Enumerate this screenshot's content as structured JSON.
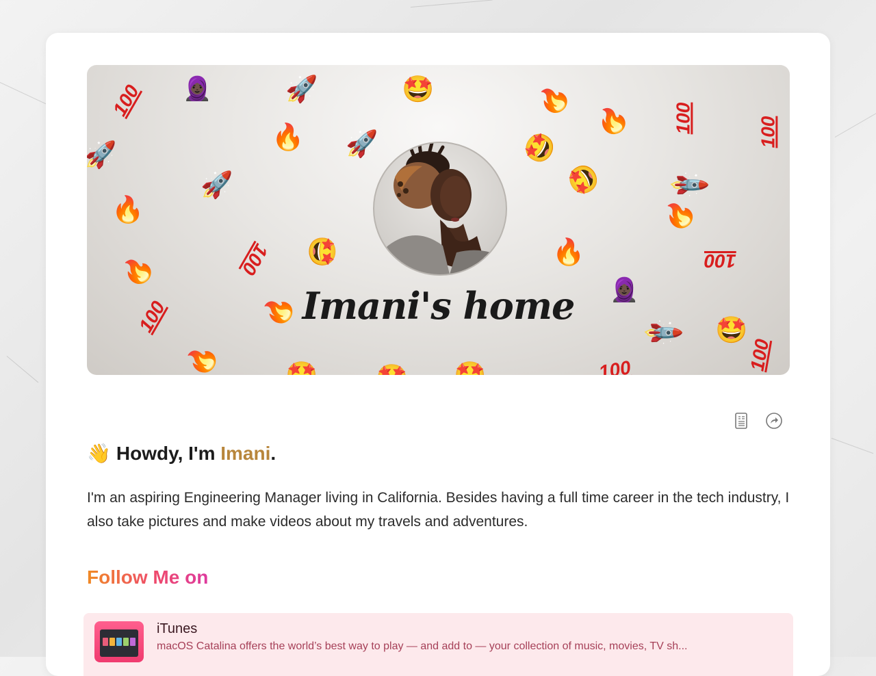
{
  "page": {
    "background": "marble"
  },
  "cover": {
    "title": "Imani's home",
    "emojis": {
      "hundred": "100",
      "rocket": "🚀",
      "fire": "🔥",
      "star_struck": "🤩",
      "woman_with_headscarf": "🧕🏿"
    }
  },
  "toolbar": {
    "icons": [
      "reader-icon",
      "share-icon"
    ]
  },
  "intro": {
    "wave_emoji": "👋",
    "greeting": "Howdy, I'm",
    "name": "Imani",
    "period": ".",
    "name_color": "#b8863c",
    "bio": "I'm an aspiring Engineering Manager living in California. Besides having a full time career in the tech industry, I also take pictures and make videos about my travels and adventures."
  },
  "follow": {
    "title": "Follow Me on",
    "links": [
      {
        "title": "iTunes",
        "description": "macOS Catalina offers the world’s best way to play — and add to — your collection of music, movies, TV sh...",
        "background": "#fde9ec"
      }
    ]
  }
}
